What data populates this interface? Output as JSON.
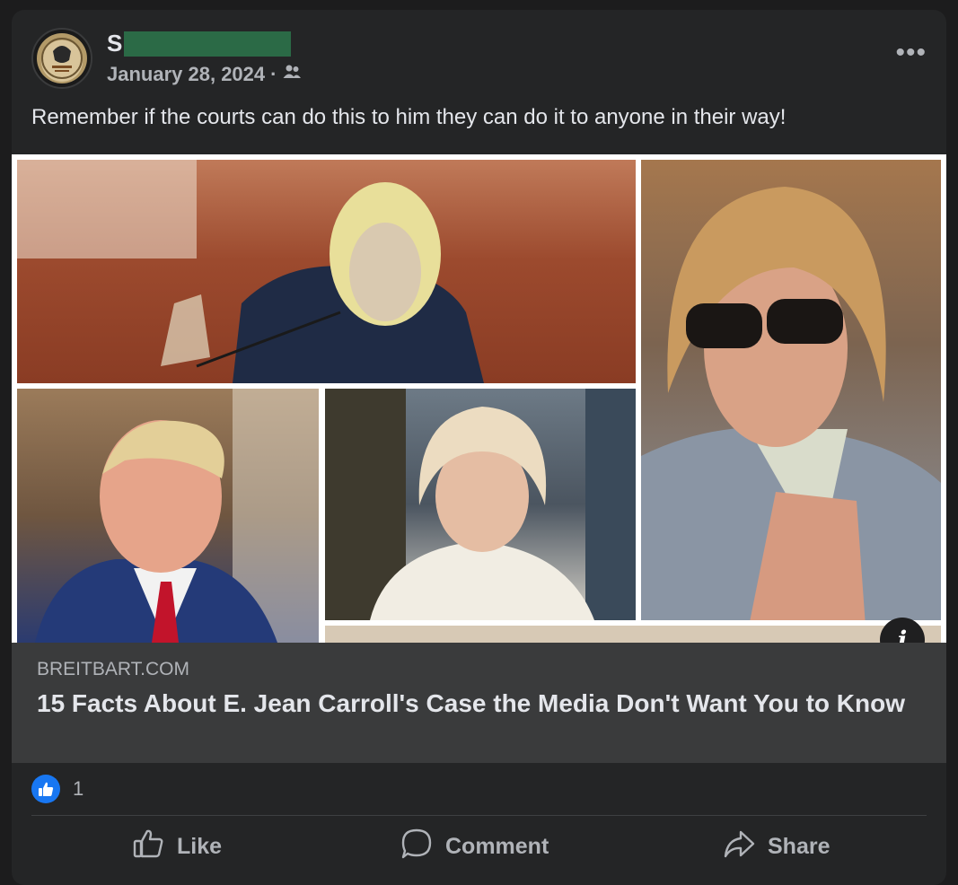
{
  "post": {
    "author_initial": "S",
    "date": "January 28, 2024",
    "separator": "·",
    "audience_icon": "friends-icon",
    "more_icon": "•••",
    "text": "Remember if the courts can do this to him they can do it to anyone in their way!"
  },
  "link": {
    "info_icon": "i",
    "domain": "BREITBART.COM",
    "title": "15 Facts About E. Jean Carroll's Case the Media Don't Want You to Know"
  },
  "reactions": {
    "icon": "like-icon",
    "count": "1"
  },
  "actions": {
    "like": "Like",
    "comment": "Comment",
    "share": "Share"
  },
  "colors": {
    "card": "#242526",
    "link_box": "#3a3b3c",
    "like_blue": "#1877f2",
    "redaction": "#2b6a46"
  }
}
